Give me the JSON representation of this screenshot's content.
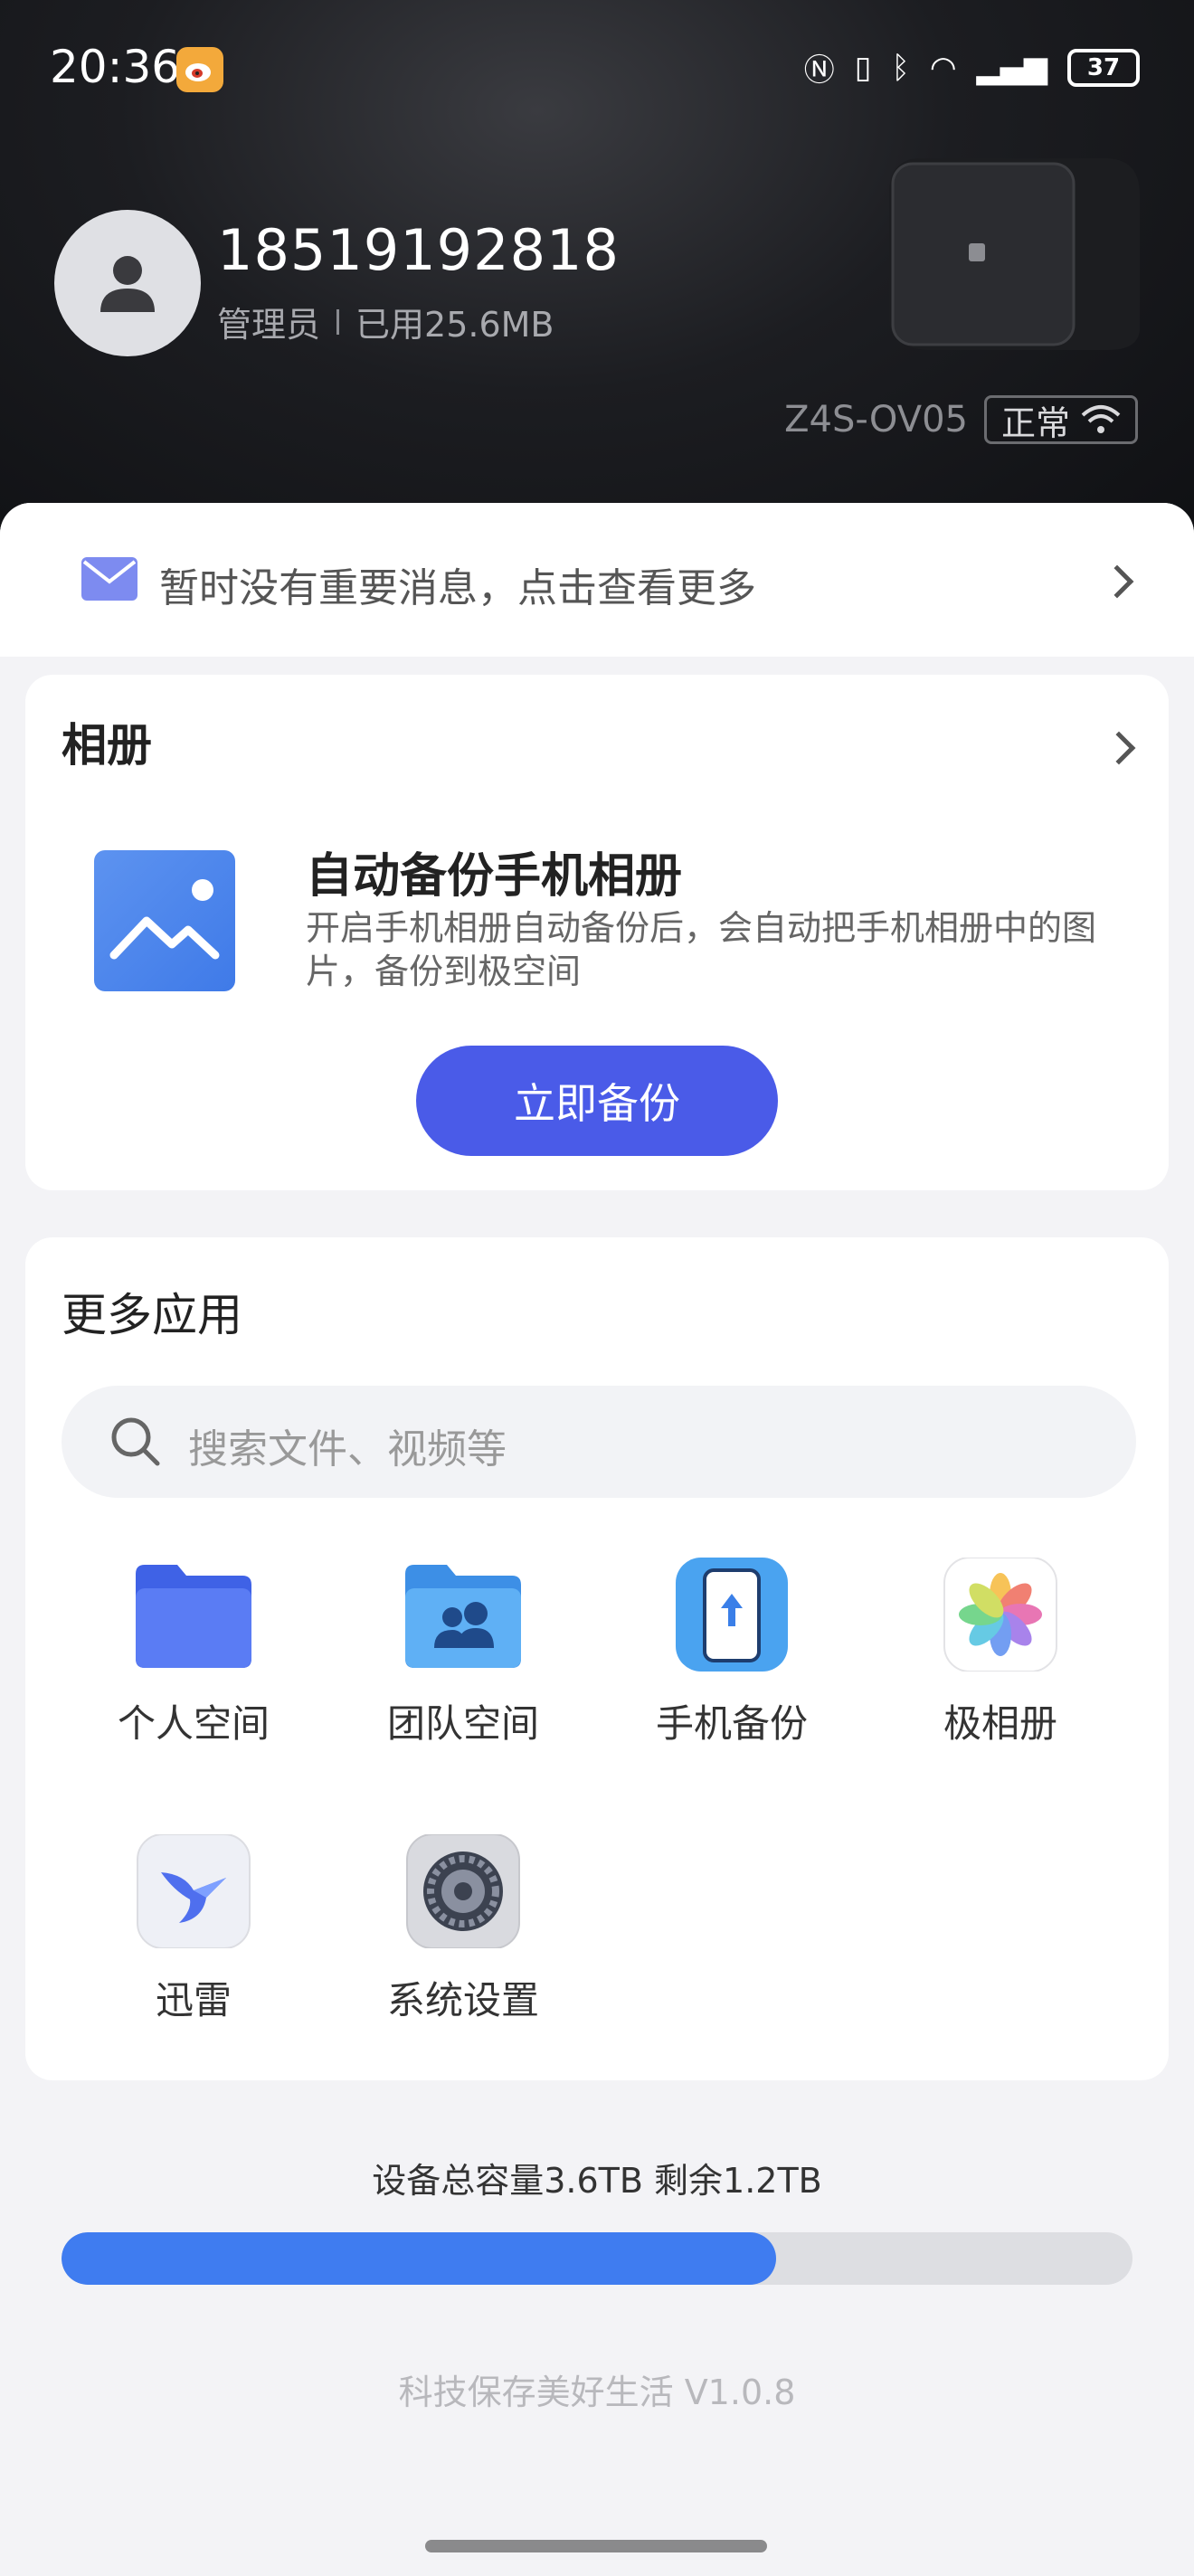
{
  "status_bar": {
    "time": "20:36",
    "battery": "37",
    "right_icons": [
      "nfc-icon",
      "vibrate-icon",
      "bluetooth-icon",
      "wifi-icon",
      "signal-icon",
      "battery-icon"
    ]
  },
  "user": {
    "phone": "18519192818",
    "role": "管理员",
    "used": "已用25.6MB"
  },
  "device": {
    "name": "Z4S-OV05",
    "status": "正常"
  },
  "notice": {
    "text": "暂时没有重要消息，点击查看更多"
  },
  "album": {
    "title": "相册",
    "backup_title": "自动备份手机相册",
    "backup_desc": "开启手机相册自动备份后，会自动把手机相册中的图片，备份到极空间",
    "button": "立即备份"
  },
  "apps": {
    "title": "更多应用",
    "search_placeholder": "搜索文件、视频等",
    "items": [
      {
        "label": "个人空间",
        "icon": "folder-icon"
      },
      {
        "label": "团队空间",
        "icon": "team-folder-icon"
      },
      {
        "label": "手机备份",
        "icon": "phone-backup-icon"
      },
      {
        "label": "极相册",
        "icon": "photos-icon"
      },
      {
        "label": "迅雷",
        "icon": "xunlei-icon"
      },
      {
        "label": "系统设置",
        "icon": "settings-gear-icon"
      }
    ]
  },
  "storage": {
    "text": "设备总容量3.6TB 剩余1.2TB",
    "used_fraction": 0.667
  },
  "footer": {
    "version": "科技保存美好生活 V1.0.8"
  },
  "colors": {
    "accent": "#4a5be8",
    "bar": "#3f7cf0"
  }
}
